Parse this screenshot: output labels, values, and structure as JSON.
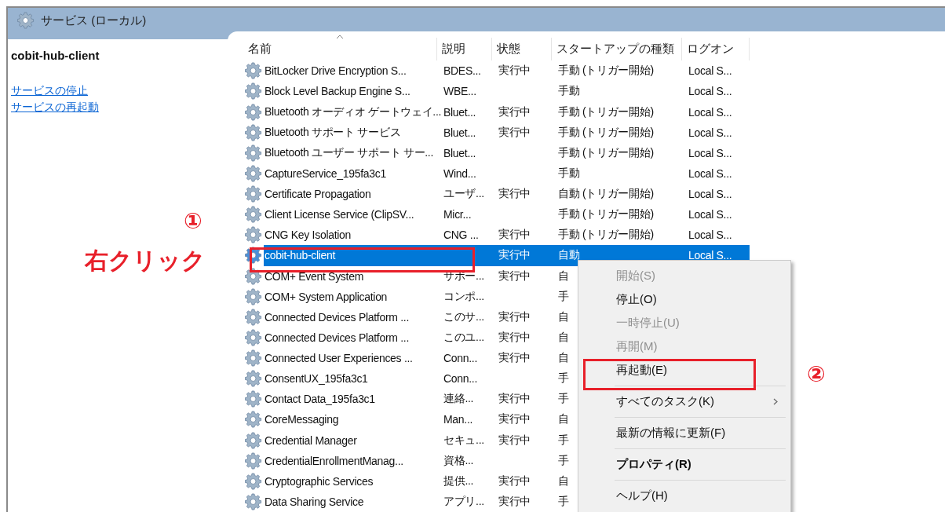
{
  "window": {
    "title": "サービス (ローカル)"
  },
  "left_panel": {
    "service_name": "cobit-hub-client",
    "links": [
      "サービスの停止",
      "サービスの再起動"
    ]
  },
  "table": {
    "columns": [
      {
        "label": "名前",
        "sorted": true
      },
      {
        "label": "説明",
        "sorted": false
      },
      {
        "label": "状態",
        "sorted": false
      },
      {
        "label": "スタートアップの種類",
        "sorted": false
      },
      {
        "label": "ログオン",
        "sorted": false
      }
    ],
    "rows": [
      {
        "name": "BitLocker Drive Encryption S...",
        "description": "BDES...",
        "status": "実行中",
        "startup": "手動 (トリガー開始)",
        "logon": "Local S...",
        "selected": false
      },
      {
        "name": "Block Level Backup Engine S...",
        "description": "WBE...",
        "startup": "手動",
        "logon": "Local S...",
        "selected": false
      },
      {
        "name": "Bluetooth オーディオ ゲートウェイ...",
        "description": "Bluet...",
        "status": "実行中",
        "startup": "手動 (トリガー開始)",
        "logon": "Local S...",
        "selected": false
      },
      {
        "name": "Bluetooth サポート サービス",
        "description": "Bluet...",
        "status": "実行中",
        "startup": "手動 (トリガー開始)",
        "logon": "Local S...",
        "selected": false
      },
      {
        "name": "Bluetooth ユーザー サポート サー...",
        "description": "Bluet...",
        "startup": "手動 (トリガー開始)",
        "logon": "Local S...",
        "selected": false
      },
      {
        "name": "CaptureService_195fa3c1",
        "description": "Wind...",
        "startup": "手動",
        "logon": "Local S...",
        "selected": false
      },
      {
        "name": "Certificate Propagation",
        "description": "ユーザ...",
        "status": "実行中",
        "startup": "自動 (トリガー開始)",
        "logon": "Local S...",
        "selected": false
      },
      {
        "name": "Client License Service (ClipSV...",
        "description": "Micr...",
        "startup": "手動 (トリガー開始)",
        "logon": "Local S...",
        "selected": false
      },
      {
        "name": "CNG Key Isolation",
        "description": "CNG ...",
        "status": "実行中",
        "startup": "手動 (トリガー開始)",
        "logon": "Local S...",
        "selected": false
      },
      {
        "name": "cobit-hub-client",
        "status": "実行中",
        "startup": "自動",
        "logon": "Local S...",
        "selected": true
      },
      {
        "name": "COM+ Event System",
        "description": "サポー...",
        "status": "実行中",
        "startup": "自",
        "selected": false
      },
      {
        "name": "COM+ System Application",
        "description": "コンポ...",
        "startup": "手",
        "selected": false
      },
      {
        "name": "Connected Devices Platform ...",
        "description": "このサ...",
        "status": "実行中",
        "startup": "自",
        "selected": false
      },
      {
        "name": "Connected Devices Platform ...",
        "description": "このユ...",
        "status": "実行中",
        "startup": "自",
        "selected": false
      },
      {
        "name": "Connected User Experiences ...",
        "description": "Conn...",
        "status": "実行中",
        "startup": "自",
        "selected": false
      },
      {
        "name": "ConsentUX_195fa3c1",
        "description": "Conn...",
        "startup": "手",
        "selected": false
      },
      {
        "name": "Contact Data_195fa3c1",
        "description": "連絡...",
        "status": "実行中",
        "startup": "手",
        "selected": false
      },
      {
        "name": "CoreMessaging",
        "description": "Man...",
        "status": "実行中",
        "startup": "自",
        "selected": false
      },
      {
        "name": "Credential Manager",
        "description": "セキュ...",
        "status": "実行中",
        "startup": "手",
        "selected": false
      },
      {
        "name": "CredentialEnrollmentManag...",
        "description": "資格...",
        "startup": "手",
        "selected": false
      },
      {
        "name": "Cryptographic Services",
        "description": "提供...",
        "status": "実行中",
        "startup": "自",
        "selected": false
      },
      {
        "name": "Data Sharing Service",
        "description": "アプリ...",
        "status": "実行中",
        "startup": "手",
        "selected": false
      }
    ]
  },
  "context_menu": {
    "items": [
      {
        "kind": "item",
        "label": "開始(S)",
        "disabled": true
      },
      {
        "kind": "item",
        "label": "停止(O)",
        "disabled": false
      },
      {
        "kind": "item",
        "label": "一時停止(U)",
        "disabled": true
      },
      {
        "kind": "item",
        "label": "再開(M)",
        "disabled": true
      },
      {
        "kind": "item",
        "label": "再起動(E)",
        "disabled": false
      },
      {
        "kind": "separator"
      },
      {
        "kind": "submenu",
        "label": "すべてのタスク(K)",
        "disabled": false
      },
      {
        "kind": "separator"
      },
      {
        "kind": "item",
        "label": "最新の情報に更新(F)",
        "disabled": false
      },
      {
        "kind": "separator"
      },
      {
        "kind": "default",
        "label": "プロパティ(R)",
        "disabled": false
      },
      {
        "kind": "separator"
      },
      {
        "kind": "item",
        "label": "ヘルプ(H)",
        "disabled": false
      }
    ]
  },
  "annotations": [
    {
      "kind": "step",
      "text": "①"
    },
    {
      "kind": "caption",
      "text": "右クリック"
    },
    {
      "kind": "step",
      "text": "②"
    }
  ]
}
